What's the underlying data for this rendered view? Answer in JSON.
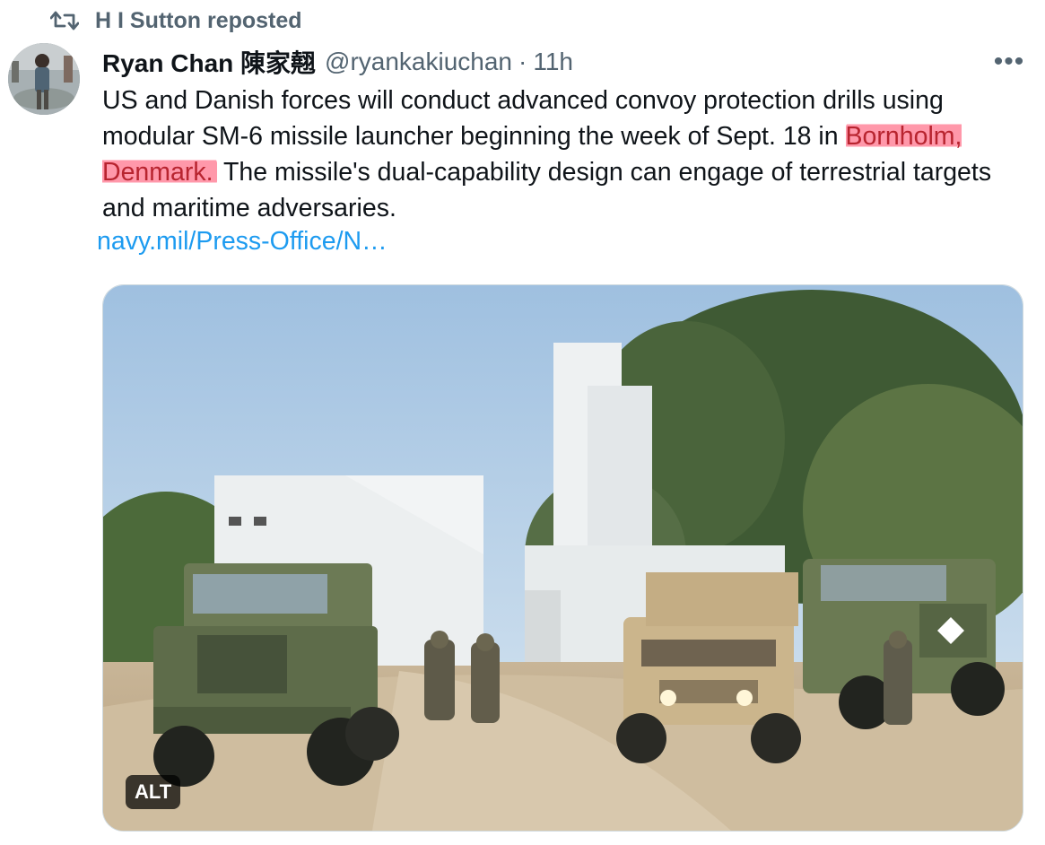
{
  "repost": {
    "icon": "repost-icon",
    "label": "H I Sutton reposted"
  },
  "author": {
    "display_name": "Ryan Chan 陳家翹",
    "handle": "@ryankakiuchan",
    "separator": "·",
    "time": "11h",
    "avatar_icon": "avatar"
  },
  "post": {
    "text_part1": "US and Danish forces will conduct advanced convoy protection drills using modular SM-6 missile launcher beginning the week of Sept. 18 in ",
    "text_highlight": "Bornholm, Denmark.",
    "text_part2": " The missile's dual-capability design can engage of terrestrial targets and maritime adversaries.",
    "link": "navy.mil/Press-Office/N…",
    "highlight_color": "#ff5876",
    "link_color": "#1d9bf0"
  },
  "media": {
    "alt_label": "ALT"
  },
  "more_icon": "more-icon",
  "colors": {
    "secondary_text": "#536471",
    "primary_text": "#0f1419"
  }
}
